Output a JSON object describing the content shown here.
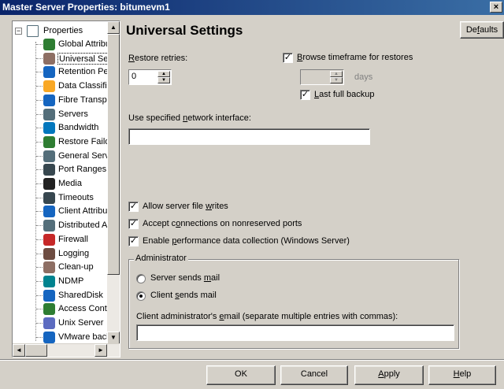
{
  "window": {
    "title": "Master Server Properties: bitumevm1",
    "close_glyph": "×"
  },
  "tree": {
    "root_label": "Properties",
    "expander_glyph": "−",
    "items": [
      {
        "label": "Global Attribut",
        "icon": "globe-icon",
        "color": "#2e7d32"
      },
      {
        "label": "Universal Setti",
        "icon": "gear-icon",
        "color": "#8d6e63"
      },
      {
        "label": "Retention Peri",
        "icon": "calendar-icon",
        "color": "#1565c0"
      },
      {
        "label": "Data Classifica",
        "icon": "classify-icon",
        "color": "#f9a825"
      },
      {
        "label": "Fibre Transpor",
        "icon": "monitor-icon",
        "color": "#1565c0"
      },
      {
        "label": "Servers",
        "icon": "server-icon",
        "color": "#546e7a"
      },
      {
        "label": "Bandwidth",
        "icon": "bandwidth-icon",
        "color": "#0277bd"
      },
      {
        "label": "Restore Failov",
        "icon": "failover-icon",
        "color": "#2e7d32"
      },
      {
        "label": "General Server",
        "icon": "server-icon",
        "color": "#546e7a"
      },
      {
        "label": "Port Ranges",
        "icon": "port-icon",
        "color": "#37474f"
      },
      {
        "label": "Media",
        "icon": "media-icon",
        "color": "#212121"
      },
      {
        "label": "Timeouts",
        "icon": "clock-icon",
        "color": "#37474f"
      },
      {
        "label": "Client Attribute",
        "icon": "client-icon",
        "color": "#1565c0"
      },
      {
        "label": "Distributed Ap",
        "icon": "distributed-icon",
        "color": "#546e7a"
      },
      {
        "label": "Firewall",
        "icon": "firewall-icon",
        "color": "#c62828"
      },
      {
        "label": "Logging",
        "icon": "logging-icon",
        "color": "#6d4c41"
      },
      {
        "label": "Clean-up",
        "icon": "cleanup-icon",
        "color": "#8d6e63"
      },
      {
        "label": "NDMP",
        "icon": "ndmp-icon",
        "color": "#00838f"
      },
      {
        "label": "SharedDisk",
        "icon": "disk-icon",
        "color": "#1565c0"
      },
      {
        "label": "Access Contro",
        "icon": "access-icon",
        "color": "#2e7d32"
      },
      {
        "label": "Unix Server",
        "icon": "server-icon",
        "color": "#5c6bc0"
      },
      {
        "label": "VMware backu",
        "icon": "vmware-icon",
        "color": "#1565c0"
      }
    ]
  },
  "panel": {
    "title": "Universal Settings",
    "defaults_button": {
      "pre": "De",
      "key": "f",
      "post": "aults"
    },
    "restore_retries": {
      "pre": "",
      "key": "R",
      "post": "estore retries:",
      "value": "0"
    },
    "browse_timeframe": {
      "pre": "",
      "key": "B",
      "post": "rowse timeframe for restores",
      "checked": true
    },
    "days_value": "",
    "days_label": "days",
    "last_full_backup": {
      "pre": "",
      "key": "L",
      "post": "ast full backup",
      "checked": true
    },
    "network_interface": {
      "pre": "Use specified ",
      "key": "n",
      "post": "etwork interface:",
      "value": ""
    },
    "allow_writes": {
      "pre": "Allow server file ",
      "key": "w",
      "post": "rites",
      "checked": true
    },
    "accept_conn": {
      "pre": "Accept c",
      "key": "o",
      "post": "nnections on nonreserved ports",
      "checked": true
    },
    "perf_collection": {
      "pre": "Enable ",
      "key": "p",
      "post": "erformance data collection (Windows Server)",
      "checked": true
    },
    "check_glyph": "✓",
    "admin_group": {
      "legend": "Administrator",
      "server_mail": {
        "pre": "Server sends ",
        "key": "m",
        "post": "ail",
        "selected": false
      },
      "client_mail": {
        "pre": "Client ",
        "key": "s",
        "post": "ends mail",
        "selected": true
      },
      "email_label": {
        "pre": "Client administrator's ",
        "key": "e",
        "post": "mail (separate multiple entries with commas):"
      },
      "email_value": ""
    }
  },
  "footer": {
    "ok": "OK",
    "cancel": "Cancel",
    "apply": {
      "pre": "",
      "key": "A",
      "post": "pply"
    },
    "help": {
      "pre": "",
      "key": "H",
      "post": "elp"
    }
  },
  "scroll_glyphs": {
    "up": "▲",
    "down": "▼",
    "left": "◄",
    "right": "►"
  }
}
